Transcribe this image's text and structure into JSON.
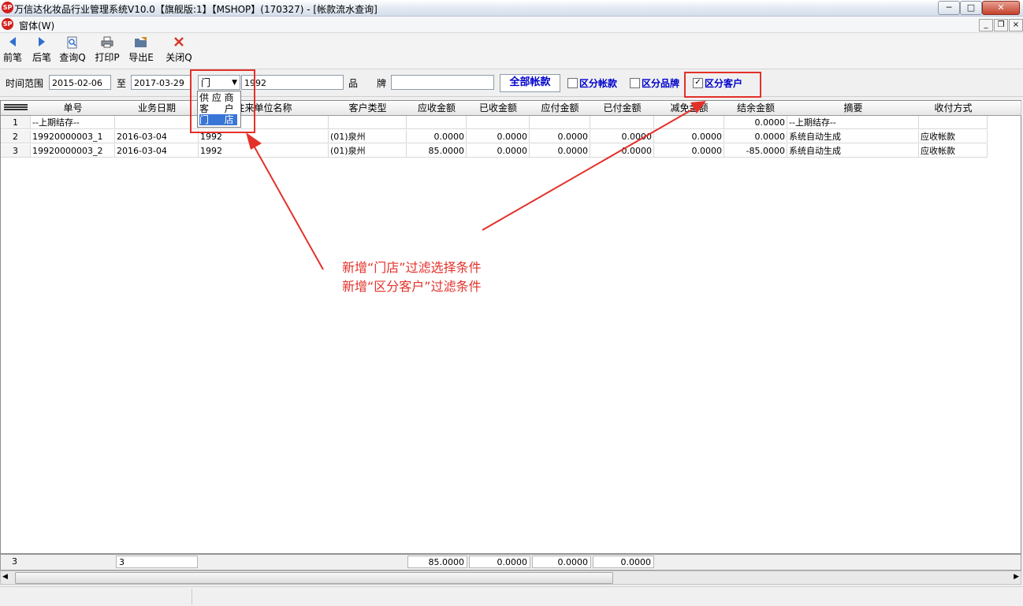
{
  "window": {
    "title": "万信达化妆品行业管理系统V10.0【旗舰版:1】【MSHOP】(170327) - [帐款流水查询]",
    "min": "─",
    "max": "□",
    "close": "✕",
    "logo_text": "SP"
  },
  "menu": {
    "window_label": "窗体(W)",
    "mdi_min": "_",
    "mdi_restore": "❐",
    "mdi_close": "×"
  },
  "toolbar": {
    "prev": "前笔",
    "next": "后笔",
    "query": "查询Q",
    "print": "打印P",
    "export": "导出E",
    "close": "关闭Q"
  },
  "filter": {
    "time_label": "时间范围",
    "date_from": "2015-02-06",
    "to_label": "至",
    "date_to": "2017-03-29",
    "type_selected": "门",
    "customer_value": "1992",
    "brand_label": "品　　牌",
    "brand_value": "",
    "all_accounts": "全部帐款",
    "split_account": "区分帐款",
    "split_brand": "区分品牌",
    "split_customer": "区分客户",
    "split_customer_checked": true
  },
  "dropdown": {
    "options": [
      "供 应 商",
      "客 　 户",
      "门 　 店"
    ],
    "selected_index": 2
  },
  "grid": {
    "columns": [
      "单号",
      "业务日期",
      "往来单位名称",
      "客户类型",
      "应收金额",
      "已收金额",
      "应付金额",
      "已付金额",
      "减免金额",
      "结余金额",
      "摘要",
      "收付方式"
    ],
    "rows": [
      {
        "no": "1",
        "cells": [
          "--上期结存--",
          "",
          "",
          "",
          "",
          "",
          "",
          "",
          "",
          "0.0000",
          "--上期结存--",
          ""
        ]
      },
      {
        "no": "2",
        "cells": [
          "19920000003_1",
          "2016-03-04",
          "1992",
          "(01)泉州",
          "0.0000",
          "0.0000",
          "0.0000",
          "0.0000",
          "0.0000",
          "0.0000",
          "系统自动生成",
          "应收帐款"
        ]
      },
      {
        "no": "3",
        "cells": [
          "19920000003_2",
          "2016-03-04",
          "1992",
          "(01)泉州",
          "85.0000",
          "0.0000",
          "0.0000",
          "0.0000",
          "0.0000",
          "-85.0000",
          "系统自动生成",
          "应收帐款"
        ]
      }
    ]
  },
  "footer": {
    "row_count": "3",
    "count_value": "3",
    "sum_receivable": "85.0000",
    "sum_received": "0.0000",
    "sum_payable": "0.0000",
    "sum_paid": "0.0000"
  },
  "annotation": {
    "line1": "新增“门店”过滤选择条件",
    "line2": "新增“区分客户”过滤条件"
  },
  "colors": {
    "annotation": "#e3312a",
    "blue_label": "#0000cc"
  }
}
